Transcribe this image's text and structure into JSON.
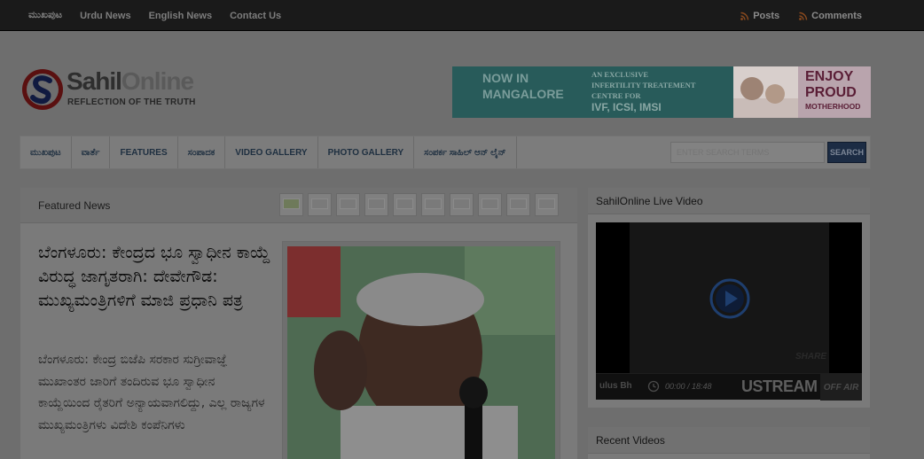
{
  "topnav": {
    "items": [
      "ಮುಖಪುಟ",
      "Urdu News",
      "English News",
      "Contact Us"
    ],
    "posts": "Posts",
    "comments": "Comments"
  },
  "logo": {
    "name_part1": "Sahil",
    "name_part2": "Online",
    "tagline": "REFLECTION OF THE TRUTH"
  },
  "banner": {
    "line1": "NOW IN",
    "line2": "MANGALORE",
    "desc1": "AN EXCLUSIVE",
    "desc2": "INFERTILITY TREATEMENT",
    "desc3": "CENTRE FOR",
    "services": "IVF, ICSI, IMSI",
    "enjoy1": "ENJOY",
    "enjoy2": "PROUD",
    "enjoy3": "MOTHERHOOD"
  },
  "mainnav": {
    "items": [
      "ಮುಖಪುಟ",
      "ವಾರ್ತೆ",
      "FEATURES",
      "ಸಂಪಾದಕ",
      "VIDEO GALLERY",
      "PHOTO GALLERY",
      "ಸಂಪರ್ಕ ಸಾಹಿಲ್ ಆನ್ ಲೈನ್"
    ],
    "search_placeholder": "ENTER SEARCH TERMS",
    "search_button": "SEARCH"
  },
  "featured": {
    "title": "Featured News",
    "headline": "ಬೆಂಗಳೂರು: ಕೇಂದ್ರದ ಭೂ ಸ್ವಾಧೀನ ಕಾಯ್ದೆ ವಿರುದ್ಧ ಜಾಗೃತರಾಗಿ: ದೇವೇಗೌಡ: ಮುಖ್ಯಮಂತ್ರಿಗಳಿಗೆ ಮಾಜಿ ಪ್ರಧಾನಿ ಪತ್ರ",
    "summary": "ಬೆಂಗಳೂರು: ಕೇಂದ್ರ ಬಿಜೆಪಿ ಸರಕಾರ ಸುಗ್ರೀವಾಜ್ಞೆ ಮುಖಾಂತರ ಜಾರಿಗೆ ತಂದಿರುವ ಭೂ ಸ್ವಾಧೀನ ಕಾಯ್ದೆಯಿಂದ ರೈತರಿಗೆ ಅನ್ಯಾಯವಾಗಲಿದ್ದು, ಎಲ್ಲ ರಾಜ್ಯಗಳ ಮುಖ್ಯಮಂತ್ರಿಗಳು ವಿದೇಶಿ ಕಂಪೆನಿಗಳು"
  },
  "sidebar": {
    "live_title": "SahilOnline Live Video",
    "share": "SHARE",
    "channel": "ulus Bh",
    "time": "00:00 / 18:48",
    "ustream": "USTREAM",
    "offair": "OFF AIR",
    "recent_title": "Recent Videos"
  }
}
